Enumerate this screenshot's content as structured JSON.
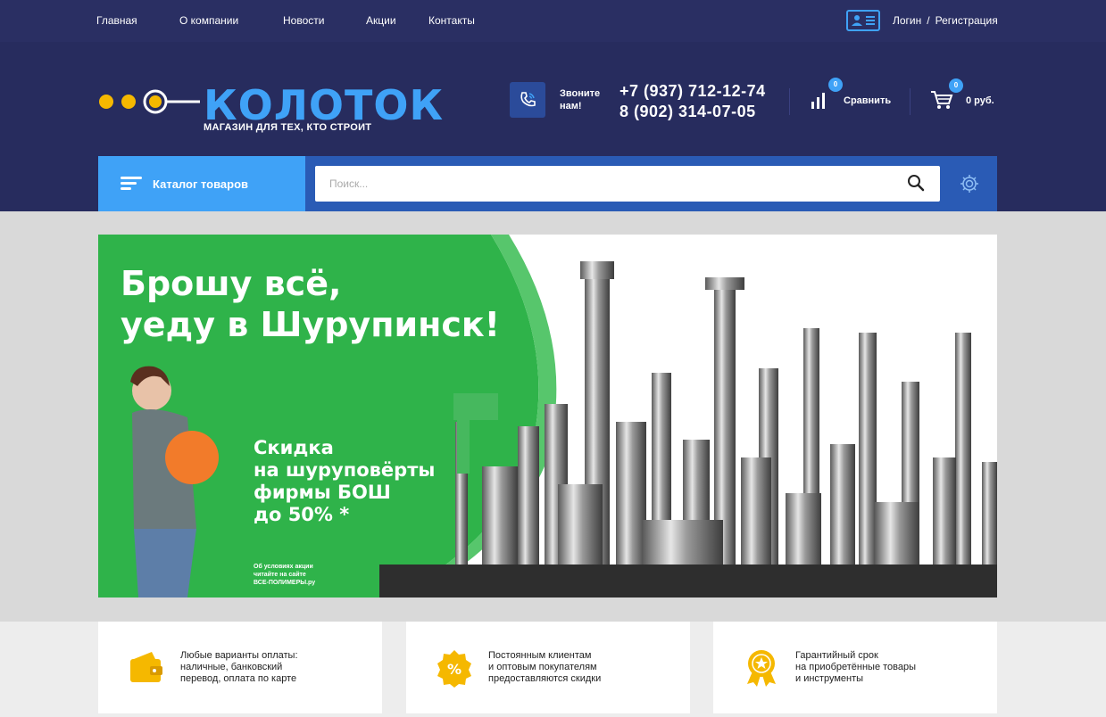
{
  "nav": {
    "items": [
      {
        "label": "Главная"
      },
      {
        "label": "О компании"
      },
      {
        "label": "Новости"
      },
      {
        "label": "Акции"
      },
      {
        "label": "Контакты"
      }
    ],
    "login": "Логин",
    "separator": "/",
    "register": "Регистрация"
  },
  "header": {
    "logo_name": "КОЛОТОК",
    "logo_tagline": "МАГАЗИН ДЛЯ ТЕХ, КТО СТРОИТ",
    "call_label_1": "Звоните",
    "call_label_2": "нам!",
    "phone_1": "+7 (937) 712-12-74",
    "phone_2": "8 (902) 314-07-05",
    "compare_count": "0",
    "compare_label": "Сравнить",
    "cart_count": "0",
    "cart_total": "0 руб."
  },
  "search": {
    "catalog_label": "Каталог товаров",
    "placeholder": "Поиск..."
  },
  "banner": {
    "title_line_1": "Брошу всё,",
    "title_line_2": "уеду в Шурупинск!",
    "promo_line_1": "Скидка",
    "promo_line_2": "на шуруповёрты",
    "promo_line_3": "фирмы БОШ",
    "promo_line_4": "до 50% *",
    "note_line_1": "Об условиях акции",
    "note_line_2": "читайте на сайте",
    "note_line_3": "ВСЕ-ПОЛИМЕРЫ.ру"
  },
  "features": [
    {
      "icon": "wallet-icon",
      "line_1": "Любые варианты оплаты:",
      "line_2": "наличные, банковский",
      "line_3": "перевод, оплата по карте"
    },
    {
      "icon": "percent-badge-icon",
      "line_1": "Постоянным клиентам",
      "line_2": "и оптовым покупателям",
      "line_3": "предоставляются скидки"
    },
    {
      "icon": "award-medal-icon",
      "line_1": "Гарантийный срок",
      "line_2": "на приобретённые товары",
      "line_3": "и инструменты"
    }
  ],
  "colors": {
    "topbar": "#2a2f63",
    "header": "#272c5e",
    "accent_blue": "#3fa2f7",
    "search_bar": "#2a5bb5",
    "banner_green": "#2fb34a",
    "icon_yellow": "#f5b800"
  }
}
